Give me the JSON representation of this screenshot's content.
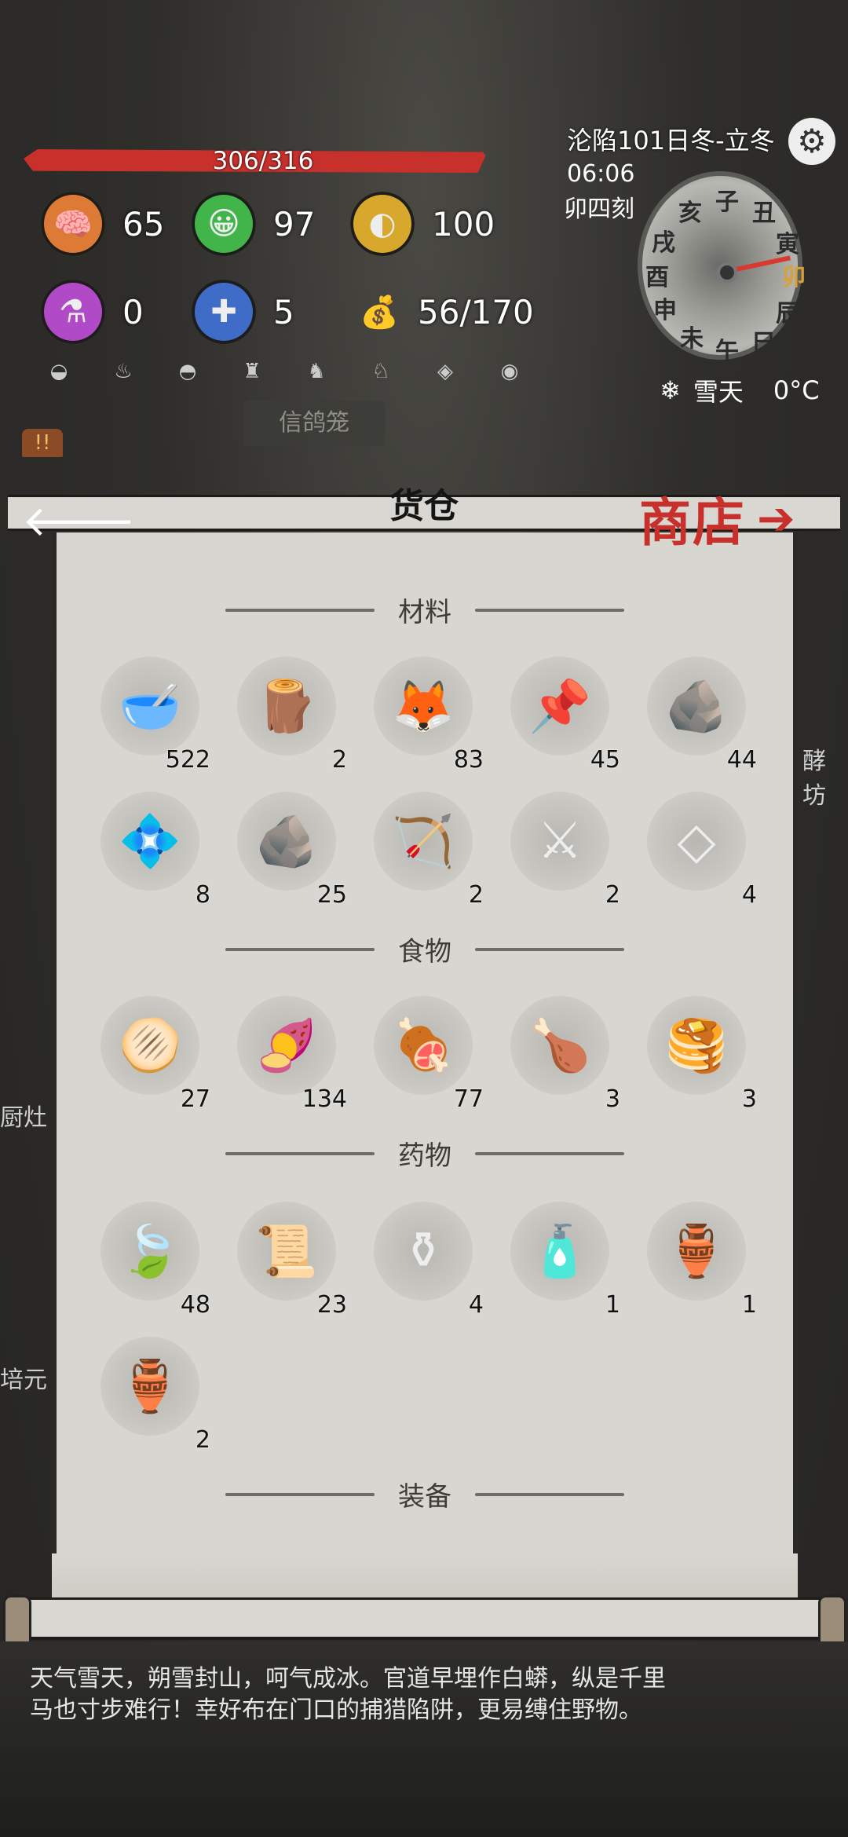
{
  "hud": {
    "hp_text": "306/316",
    "hp_fraction": 0.968,
    "stats": {
      "mood": "65",
      "happiness": "97",
      "hunger": "100",
      "potion": "0",
      "bandage": "5",
      "carry": "56/170"
    },
    "date": "沦陷101日冬-立冬",
    "time": "06:06",
    "hour": "卯四刻",
    "weather": "雪天",
    "temperature": "0°C",
    "dial_chars": [
      "子",
      "丑",
      "寅",
      "卯",
      "辰",
      "巳",
      "午",
      "未",
      "申",
      "酉",
      "戌",
      "亥"
    ],
    "pigeon_label": "信鸽笼"
  },
  "nav": {
    "title": "货仓",
    "shop_label": "商店"
  },
  "sections": {
    "materials": {
      "name": "材料",
      "items": [
        {
          "icon": "bowl-icon",
          "count": "522"
        },
        {
          "icon": "wood-log-icon",
          "count": "2"
        },
        {
          "icon": "animal-hide-icon",
          "count": "83"
        },
        {
          "icon": "nails-icon",
          "count": "45"
        },
        {
          "icon": "ore-pile-icon",
          "count": "44"
        },
        {
          "icon": "jade-slab-icon",
          "count": "8"
        },
        {
          "icon": "stone-icon",
          "count": "25"
        },
        {
          "icon": "bow-icon",
          "count": "2"
        },
        {
          "icon": "crossbow-icon",
          "count": "2"
        },
        {
          "icon": "shards-icon",
          "count": "4"
        }
      ]
    },
    "food": {
      "name": "食物",
      "items": [
        {
          "icon": "flatbread-icon",
          "count": "27"
        },
        {
          "icon": "sweet-potato-icon",
          "count": "134"
        },
        {
          "icon": "ham-icon",
          "count": "77"
        },
        {
          "icon": "roast-leg-icon",
          "count": "3"
        },
        {
          "icon": "pancake-stack-icon",
          "count": "3"
        }
      ]
    },
    "medicine": {
      "name": "药物",
      "items": [
        {
          "icon": "leaf-pill-icon",
          "count": "48"
        },
        {
          "icon": "herb-paper-icon",
          "count": "23"
        },
        {
          "icon": "white-bottle-icon",
          "count": "4"
        },
        {
          "icon": "bottle-scroll-icon",
          "count": "1"
        },
        {
          "icon": "purple-vase-icon",
          "count": "1"
        },
        {
          "icon": "orange-jar-icon",
          "count": "2"
        }
      ]
    },
    "equipment": {
      "name": "装备"
    }
  },
  "log": {
    "line1": "天气雪天，朔雪封山，呵气成冰。官道早埋作白蟒，纵是千里",
    "line2": "马也寸步难行！幸好布在门口的捕猎陷阱，更易缚住野物。"
  },
  "side": {
    "left_kitchen": "厨灶",
    "left_bottom": "培元",
    "right_top": "酵坊"
  }
}
